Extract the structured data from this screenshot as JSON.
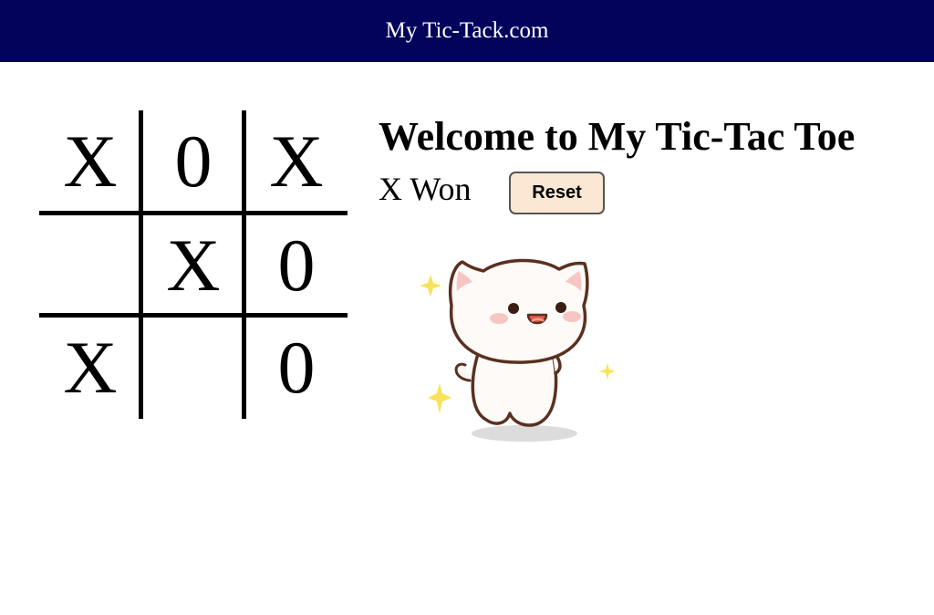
{
  "header": {
    "title": "My Tic-Tack.com"
  },
  "board": {
    "cells": [
      "X",
      "0",
      "X",
      "",
      "X",
      "0",
      "X",
      "",
      "0"
    ]
  },
  "main": {
    "title": "Welcome to My Tic-Tac Toe",
    "status": "X Won",
    "reset_label": "Reset"
  },
  "colors": {
    "header_bg": "#03035c",
    "reset_bg": "#fbe8d4"
  },
  "image": {
    "icon": "cat-celebrating-icon"
  }
}
